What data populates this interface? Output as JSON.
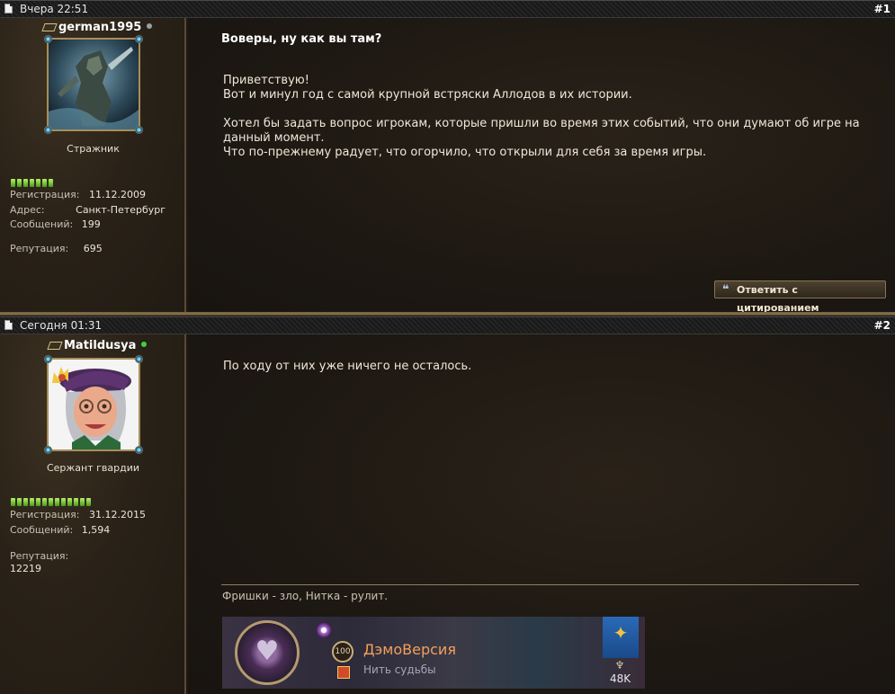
{
  "posts": [
    {
      "header": {
        "date": "Вчера 22:51",
        "number": "#1"
      },
      "user": {
        "name": "german1995",
        "status_color": "#9aa0a6",
        "rank": "Стражник",
        "reputation_pips": 7,
        "info": [
          {
            "label": "Регистрация:",
            "value": "11.12.2009"
          },
          {
            "label": "Адрес:",
            "value": "Санкт-Петербург"
          },
          {
            "label": "Сообщений:",
            "value": "199"
          },
          {
            "label": "Репутация:",
            "value": "695"
          }
        ]
      },
      "title": "Воверы, ну как вы там?",
      "body": [
        "Приветствую!",
        "Вот и минул год с самой крупной встряски Аллодов в их истории.",
        "",
        "Хотел бы задать вопрос игрокам, которые пришли во время этих событий, что они думают об игре на",
        "данный момент.",
        "Что по-прежнему радует, что огорчило, что открыли для себя за время игры."
      ],
      "quote_button": "Ответить с цитированием"
    },
    {
      "header": {
        "date": "Сегодня 01:31",
        "number": "#2"
      },
      "user": {
        "name": "Matildusya",
        "status_color": "#3fd03f",
        "rank": "Сержант гвардии",
        "reputation_pips": 13,
        "info": [
          {
            "label": "Регистрация:",
            "value": "31.12.2015"
          },
          {
            "label": "Сообщений:",
            "value": "1,594"
          },
          {
            "label": "Репутация:",
            "value": "12219"
          }
        ]
      },
      "body": [
        "По ходу от них уже ничего не осталось."
      ],
      "signature": "Фришки - зло, Нитка - рулит.",
      "banner": {
        "level": "100",
        "character": "ДэмоВерсия",
        "server": "Нить судьбы",
        "count": "48K"
      }
    }
  ],
  "colors": {
    "accent_gold": "#a88e5b",
    "rep_green": "#7ed43a",
    "banner_name": "#f3a05a"
  }
}
